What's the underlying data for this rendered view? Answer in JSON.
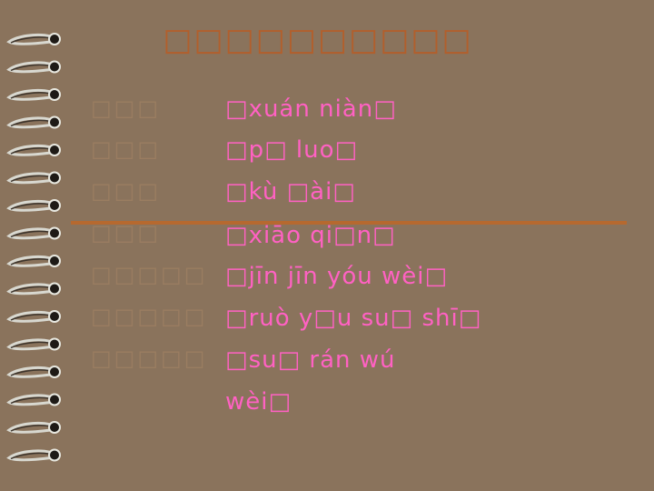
{
  "title": "□□□□□□□□□□",
  "rows": [
    {
      "word": "□□□",
      "pinyin": "□xuán  niàn□"
    },
    {
      "word": "□□□",
      "pinyin": "□p□  luo□"
    },
    {
      "word": "□□□",
      "pinyin": "□kù  □ài□"
    },
    {
      "word": "□□□",
      "pinyin": "□xiāo  qi□n□"
    },
    {
      "word": "□□□□□",
      "pinyin": "□jīn  jīn  yóu  wèi□"
    },
    {
      "word": "□□□□□",
      "pinyin": "□ruò  y□u  su□  shī□"
    },
    {
      "word": "□□□□□",
      "pinyin": "□su□  rán  wú  wèi□"
    }
  ],
  "colors": {
    "background": "#8a735c",
    "pinyin": "#ff61c3",
    "title": "#b25f2c",
    "rule": "#b6692f"
  }
}
